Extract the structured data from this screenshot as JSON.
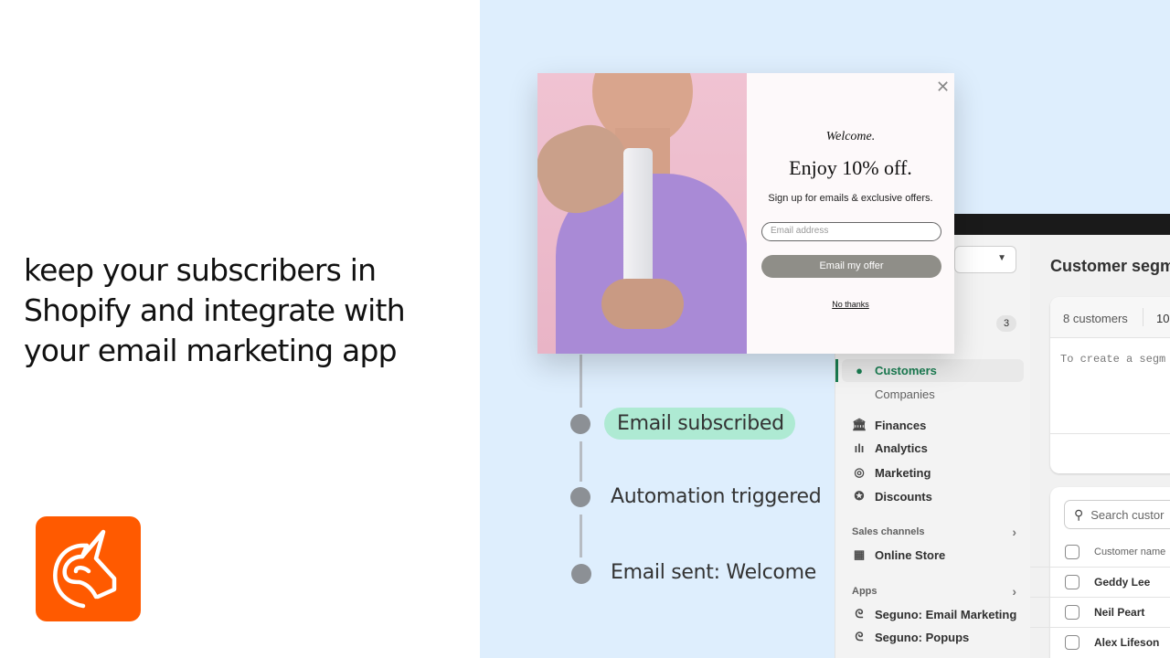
{
  "headline": "keep your subscribers in Shopify and integrate with your email marketing app",
  "brand": {
    "logo": "seguno-unicorn-logo",
    "color": "#ff5a00"
  },
  "timeline": {
    "steps": [
      {
        "label": "Email subscribed",
        "highlight": "#aeead3"
      },
      {
        "label": "Automation triggered"
      },
      {
        "label": "Email sent: Welcome"
      }
    ]
  },
  "popup": {
    "greeting": "Welcome.",
    "title": "Enjoy 10% off.",
    "subtitle": "Sign up for emails & exclusive offers.",
    "email_placeholder": "Email address",
    "cta": "Email my offer",
    "dismiss": "No thanks",
    "close_icon": "close-icon"
  },
  "sidebar": {
    "badge": "3",
    "items": [
      {
        "label": "Customers",
        "icon": "person-icon",
        "active": true
      },
      {
        "label": "Companies"
      },
      {
        "label": "Finances",
        "icon": "bank-icon"
      },
      {
        "label": "Analytics",
        "icon": "bar-chart-icon"
      },
      {
        "label": "Marketing",
        "icon": "target-icon"
      },
      {
        "label": "Discounts",
        "icon": "discount-icon"
      }
    ],
    "sales_channels": {
      "title": "Sales channels",
      "items": [
        {
          "label": "Online Store",
          "icon": "store-icon"
        }
      ]
    },
    "apps": {
      "title": "Apps",
      "items": [
        {
          "label": "Seguno: Email Marketing",
          "icon": "seguno-icon"
        },
        {
          "label": "Seguno: Popups",
          "icon": "seguno-icon"
        }
      ]
    }
  },
  "main": {
    "title": "Customer segm",
    "count": "8 customers",
    "percent": "10",
    "query_placeholder": "To create a segm",
    "search_placeholder": "Search custor",
    "column": "Customer name",
    "rows": [
      "Geddy Lee",
      "Neil Peart",
      "Alex Lifeson"
    ]
  }
}
